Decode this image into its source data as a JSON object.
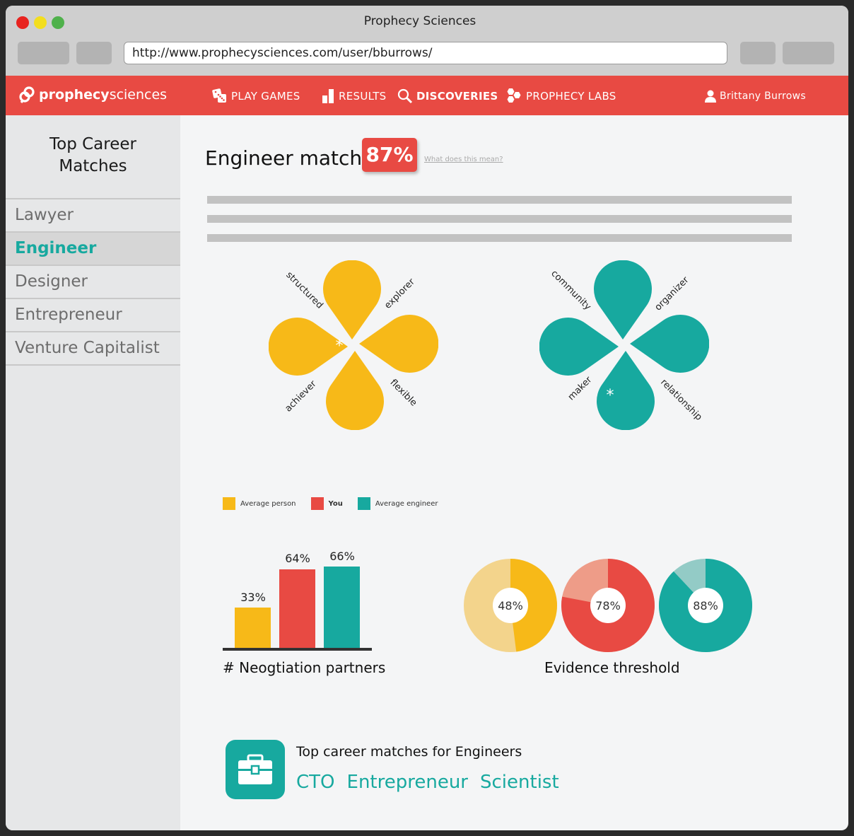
{
  "window": {
    "title": "Prophecy Sciences",
    "url": "http://www.prophecysciences.com/user/bburrows/"
  },
  "colors": {
    "brand_red": "#e84a43",
    "teal": "#17a99f",
    "yellow": "#f7b918",
    "sidebar_bg": "#e6e7e8"
  },
  "nav": {
    "logo_bold": "prophecy",
    "logo_light": "sciences",
    "items": [
      {
        "label": "PLAY GAMES",
        "icon": "dice-icon"
      },
      {
        "label": "RESULTS",
        "icon": "bar-chart-icon"
      },
      {
        "label": "DISCOVERIES",
        "icon": "search-icon"
      },
      {
        "label": "PROPHECY LABS",
        "icon": "hexagon-cluster-icon"
      }
    ],
    "user": "Brittany Burrows"
  },
  "sidebar": {
    "title_line1": "Top Career",
    "title_line2": "Matches",
    "items": [
      {
        "label": "Lawyer"
      },
      {
        "label": "Engineer",
        "active": true
      },
      {
        "label": "Designer"
      },
      {
        "label": "Entrepreneur"
      },
      {
        "label": "Venture Capitalist"
      }
    ]
  },
  "main": {
    "match_title": "Engineer match:",
    "match_value": "87%",
    "what_link": "What does this mean?",
    "clover_left": {
      "labels": [
        "structured",
        "explorer",
        "achiever",
        "flexible"
      ],
      "marker": "*"
    },
    "clover_right": {
      "labels": [
        "community",
        "organizer",
        "maker",
        "relationship"
      ],
      "marker": "*"
    },
    "legend": {
      "average_person": "Average person",
      "you": "You",
      "average_engineer": "Average engineer"
    },
    "bar_caption": "# Neogtiation partners",
    "donut_caption": "Evidence threshold",
    "careers_title": "Top career matches for Engineers",
    "careers": [
      "CTO",
      "Entrepreneur",
      "Scientist"
    ]
  },
  "chart_data": [
    {
      "type": "bar",
      "categories": [
        "Average person",
        "You",
        "Average engineer"
      ],
      "values": [
        33,
        64,
        66
      ],
      "labels": [
        "33%",
        "64%",
        "66%"
      ],
      "colors": [
        "#f7b918",
        "#e84a43",
        "#17a99f"
      ],
      "xlabel": "# Neogtiation partners"
    },
    {
      "type": "pie",
      "series": [
        {
          "name": "Average person",
          "value": 48,
          "label": "48%",
          "color": "#f7b918",
          "light": "#f3d48c"
        },
        {
          "name": "You",
          "value": 78,
          "label": "78%",
          "color": "#e84a43",
          "light": "#ee9c88"
        },
        {
          "name": "Average engineer",
          "value": 88,
          "label": "88%",
          "color": "#17a99f",
          "light": "#93cbc6"
        }
      ],
      "xlabel": "Evidence threshold"
    }
  ]
}
